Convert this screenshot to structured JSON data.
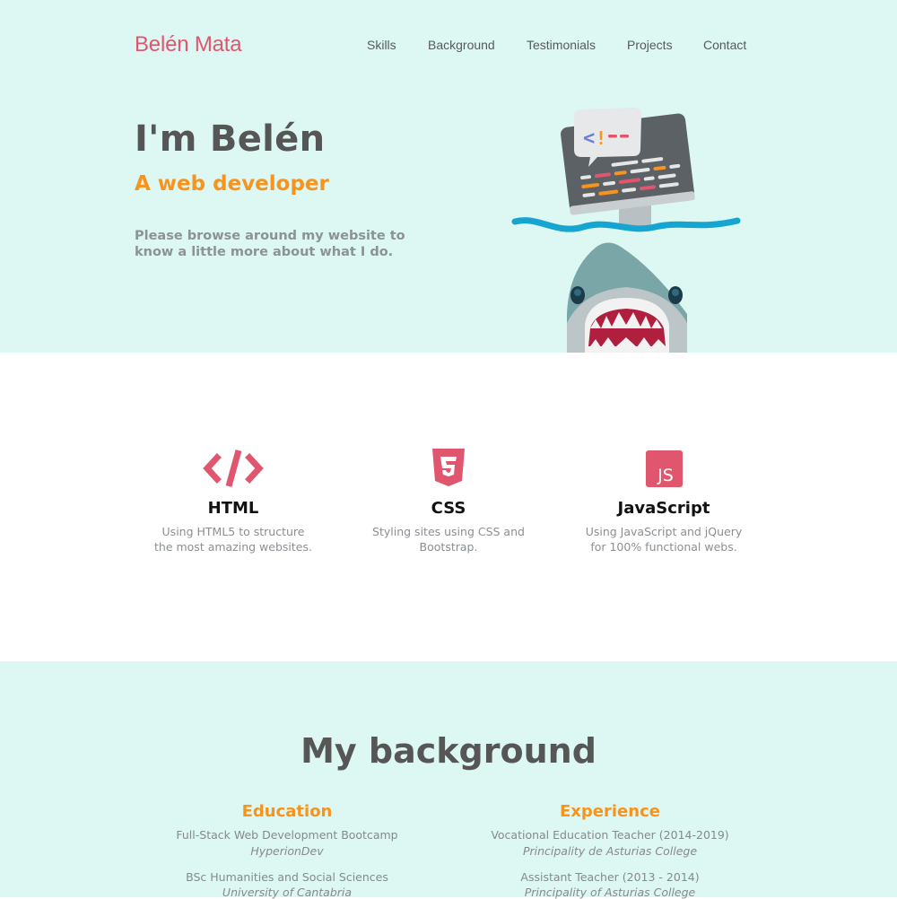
{
  "header": {
    "brand": "Belén Mata",
    "nav": [
      "Skills",
      "Background",
      "Testimonials",
      "Projects",
      "Contact"
    ]
  },
  "hero": {
    "title": "I'm Belén",
    "subtitle": "A web developer",
    "text": "Please browse around my website to know a little more about what I do."
  },
  "skills": [
    {
      "icon": "code-icon",
      "title": "HTML",
      "desc_line1": "Using HTML5 to structure",
      "desc_line2": "the most amazing websites."
    },
    {
      "icon": "css3-icon",
      "title": "CSS",
      "desc_line1": "Styling sites using CSS and",
      "desc_line2": "Bootstrap."
    },
    {
      "icon": "js-icon",
      "title": "JavaScript",
      "desc_line1": "Using JavaScript and jQuery",
      "desc_line2": "for 100% functional webs."
    }
  ],
  "background": {
    "title": "My background",
    "education": {
      "heading": "Education",
      "items": [
        {
          "title": "Full-Stack Web Development Bootcamp",
          "place": "HyperionDev"
        },
        {
          "title": "BSc Humanities and Social Sciences",
          "place": "University of Cantabria"
        }
      ]
    },
    "experience": {
      "heading": "Experience",
      "items": [
        {
          "title": "Vocational Education Teacher (2014-2019)",
          "place": "Principality de Asturias College"
        },
        {
          "title": "Assistant Teacher (2013 - 2014)",
          "place": "Principality of Asturias College"
        }
      ]
    }
  },
  "colors": {
    "accent_pink": "#e0566f",
    "accent_orange": "#f7941d",
    "mint_bg": "#ddf7f2",
    "heading_gray": "#565656"
  }
}
